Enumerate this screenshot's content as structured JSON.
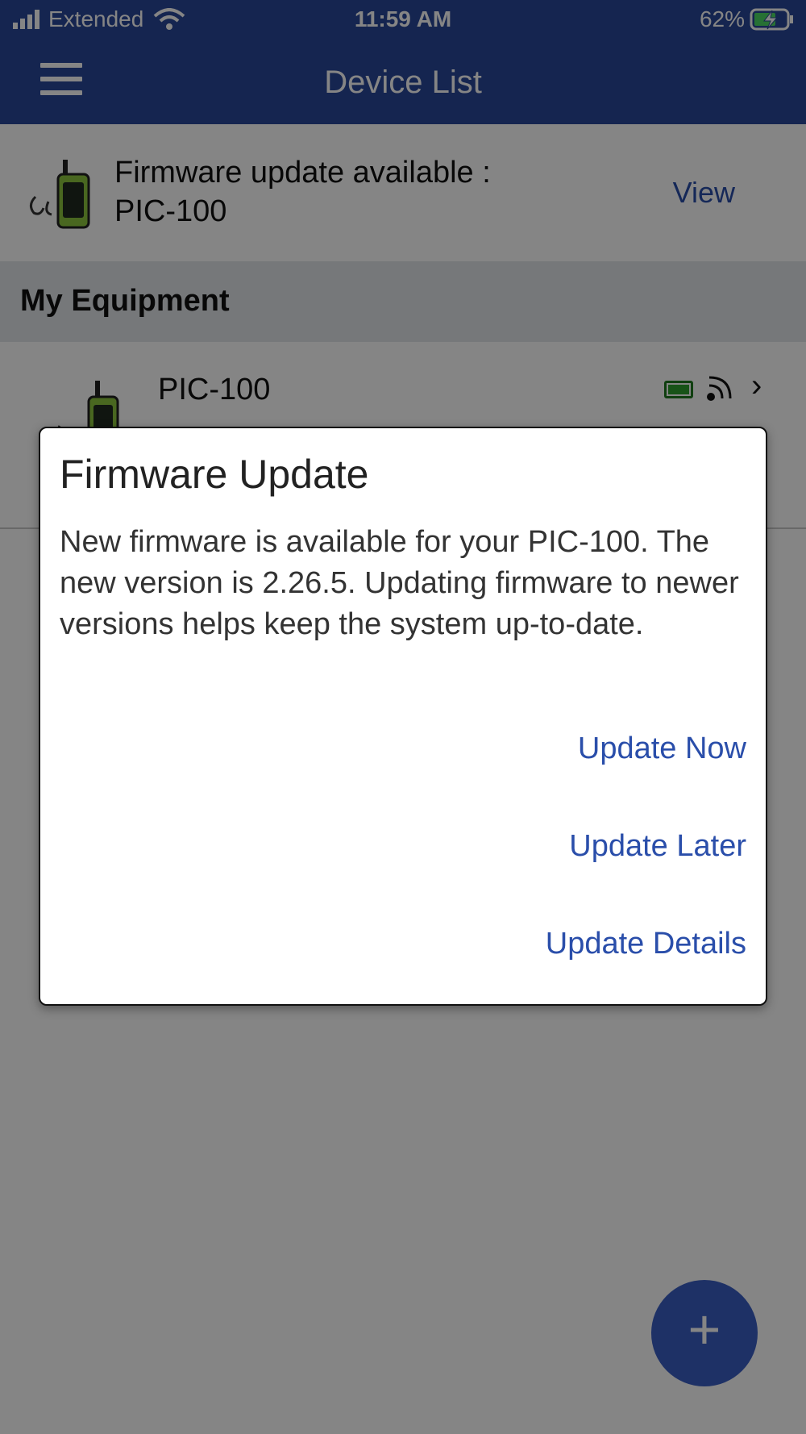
{
  "status_bar": {
    "carrier": "Extended",
    "time": "11:59 AM",
    "battery_percent": "62%"
  },
  "app_bar": {
    "title": "Device List",
    "menu_icon": "hamburger-menu-icon"
  },
  "banner": {
    "line1": "Firmware update available :",
    "line2": "PIC-100",
    "view_label": "View"
  },
  "section": {
    "label": "My Equipment"
  },
  "device": {
    "name": "PIC-100",
    "battery_icon": "battery-icon",
    "signal_icon": "signal-icon",
    "chevron_icon": "chevron-right-icon"
  },
  "dialog": {
    "title": "Firmware Update",
    "message": "New firmware is available for your PIC-100. The new version is 2.26.5. Updating firmware to newer versions helps keep the system up-to-date.",
    "buttons": {
      "update_now": "Update Now",
      "update_later": "Update Later",
      "update_details": "Update Details"
    }
  },
  "fab": {
    "icon": "plus-icon",
    "symbol": "+"
  },
  "colors": {
    "primary": "#2a4799",
    "accent_link": "#2a4eaa",
    "fab": "#3b5fc4",
    "section_bg": "#e2e6ea"
  }
}
